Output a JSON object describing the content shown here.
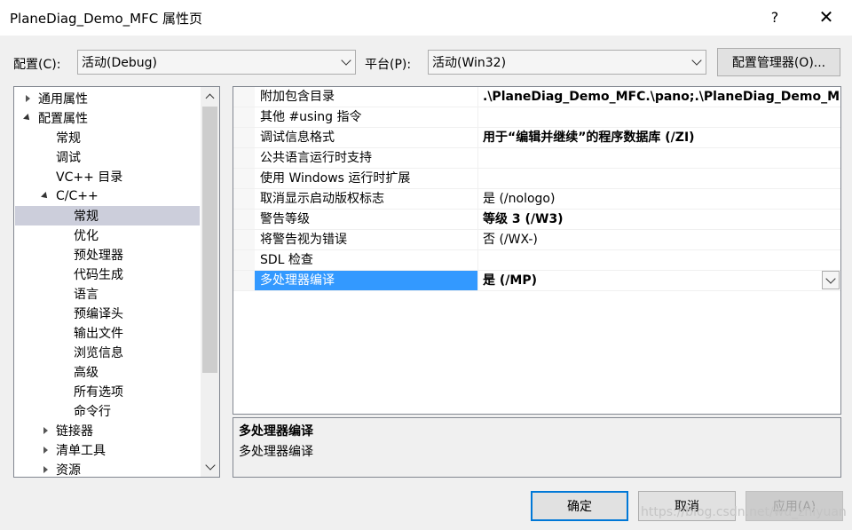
{
  "window": {
    "title": "PlaneDiag_Demo_MFC 属性页",
    "help_glyph": "?",
    "close_glyph": "✕"
  },
  "config_bar": {
    "config_label": "配置(C):",
    "config_value": "活动(Debug)",
    "platform_label": "平台(P):",
    "platform_value": "活动(Win32)",
    "manager_button": "配置管理器(O)..."
  },
  "tree": {
    "items": [
      {
        "label": "通用属性",
        "level": 0,
        "expander": "collapsed"
      },
      {
        "label": "配置属性",
        "level": 0,
        "expander": "expanded"
      },
      {
        "label": "常规",
        "level": 1,
        "expander": "none"
      },
      {
        "label": "调试",
        "level": 1,
        "expander": "none"
      },
      {
        "label": "VC++ 目录",
        "level": 1,
        "expander": "none"
      },
      {
        "label": "C/C++",
        "level": 1,
        "expander": "expanded"
      },
      {
        "label": "常规",
        "level": 2,
        "expander": "none",
        "selected": true
      },
      {
        "label": "优化",
        "level": 2,
        "expander": "none"
      },
      {
        "label": "预处理器",
        "level": 2,
        "expander": "none"
      },
      {
        "label": "代码生成",
        "level": 2,
        "expander": "none"
      },
      {
        "label": "语言",
        "level": 2,
        "expander": "none"
      },
      {
        "label": "预编译头",
        "level": 2,
        "expander": "none"
      },
      {
        "label": "输出文件",
        "level": 2,
        "expander": "none"
      },
      {
        "label": "浏览信息",
        "level": 2,
        "expander": "none"
      },
      {
        "label": "高级",
        "level": 2,
        "expander": "none"
      },
      {
        "label": "所有选项",
        "level": 2,
        "expander": "none"
      },
      {
        "label": "命令行",
        "level": 2,
        "expander": "none"
      },
      {
        "label": "链接器",
        "level": 1,
        "expander": "collapsed"
      },
      {
        "label": "清单工具",
        "level": 1,
        "expander": "collapsed"
      },
      {
        "label": "资源",
        "level": 1,
        "expander": "collapsed"
      }
    ]
  },
  "grid": {
    "rows": [
      {
        "name": "附加包含目录",
        "value": ".\\PlaneDiag_Demo_MFC.\\pano;.\\PlaneDiag_Demo_MF",
        "bold": true
      },
      {
        "name": "其他 #using 指令",
        "value": "",
        "bold": false
      },
      {
        "name": "调试信息格式",
        "value": "用于“编辑并继续”的程序数据库 (/ZI)",
        "bold": true
      },
      {
        "name": "公共语言运行时支持",
        "value": "",
        "bold": false
      },
      {
        "name": "使用 Windows 运行时扩展",
        "value": "",
        "bold": false
      },
      {
        "name": "取消显示启动版权标志",
        "value": "是 (/nologo)",
        "bold": false
      },
      {
        "name": "警告等级",
        "value": "等级 3 (/W3)",
        "bold": true
      },
      {
        "name": "将警告视为错误",
        "value": "否 (/WX-)",
        "bold": false
      },
      {
        "name": "SDL 检查",
        "value": "",
        "bold": false
      },
      {
        "name": "多处理器编译",
        "value": "是 (/MP)",
        "bold": true,
        "selected": true
      }
    ]
  },
  "description": {
    "title": "多处理器编译",
    "text": "多处理器编译"
  },
  "buttons": {
    "ok": "确定",
    "cancel": "取消",
    "apply": "应用(A)"
  },
  "watermark": "https://blog.csdn.net/wu_zhiyuan"
}
